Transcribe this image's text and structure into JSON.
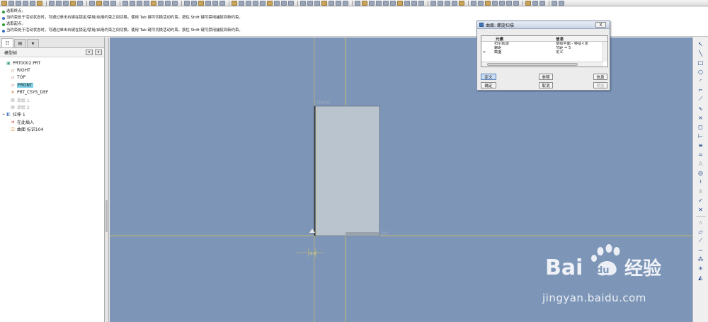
{
  "messages": [
    {
      "type": "ok",
      "text": "选取终点。"
    },
    {
      "type": "info",
      "text": "当约束处于活动状态时，可通过单击右键在锁定/禁用/启用约束之间切换。使用 Tab 键可切换活动约束。按住 Shift 键可禁用捕捉到新约束。"
    },
    {
      "type": "ok",
      "text": "选取起点。"
    },
    {
      "type": "info",
      "text": "当约束处于活动状态时，可通过单击右键在锁定/禁用/启用约束之间切换。使用 Tab 键可切换活动约束。按住 Shift 键可禁用捕捉到新约束。"
    }
  ],
  "model_tree": {
    "header": "模型树",
    "items": [
      {
        "label": "PRT0002.PRT",
        "icon": "part-icon",
        "indent": 0,
        "selected": false,
        "dim": false,
        "expander": ""
      },
      {
        "label": "RIGHT",
        "icon": "datum-plane-icon",
        "indent": 1,
        "selected": false,
        "dim": false,
        "expander": ""
      },
      {
        "label": "TOP",
        "icon": "datum-plane-icon",
        "indent": 1,
        "selected": false,
        "dim": false,
        "expander": ""
      },
      {
        "label": "FRONT",
        "icon": "datum-plane-icon",
        "indent": 1,
        "selected": true,
        "dim": false,
        "expander": ""
      },
      {
        "label": "PRT_CSYS_DEF",
        "icon": "csys-icon",
        "indent": 1,
        "selected": false,
        "dim": false,
        "expander": ""
      },
      {
        "label": "草绘 1",
        "icon": "sketch-icon",
        "indent": 1,
        "selected": false,
        "dim": true,
        "expander": ""
      },
      {
        "label": "草绘 2",
        "icon": "sketch-icon",
        "indent": 1,
        "selected": false,
        "dim": true,
        "expander": ""
      },
      {
        "label": "拉伸 1",
        "icon": "extrude-icon",
        "indent": 0,
        "selected": false,
        "dim": false,
        "expander": "+"
      },
      {
        "label": "在此插入",
        "icon": "insert-here-icon",
        "indent": 1,
        "selected": false,
        "dim": false,
        "expander": ""
      },
      {
        "label": "曲面 标识104",
        "icon": "surface-icon",
        "indent": 1,
        "selected": false,
        "dim": false,
        "expander": ""
      }
    ]
  },
  "dialog": {
    "title": "曲面: 螺旋扫描",
    "close_label": "X",
    "col_element": "元素",
    "col_info": "信息",
    "rows": [
      {
        "mark": "",
        "element": "扫引轨迹",
        "info": "草绘平面 - 特征<定"
      },
      {
        "mark": "",
        "element": "螺距",
        "info": "节距 = 5"
      },
      {
        "mark": ">",
        "element": "截面",
        "info": "定义"
      }
    ],
    "buttons": {
      "define": "定义",
      "refs": "参照",
      "info": "信息",
      "ok": "确定",
      "cancel": "取消",
      "preview": "预览"
    }
  },
  "graphics": {
    "labels": {
      "front": "FRONT",
      "top": "TOP",
      "dim_value": "0.0"
    },
    "colors": {
      "background": "#7d96b8",
      "surface": "#b9c4cf",
      "datum": "#d9c25a"
    }
  },
  "watermark": {
    "logo_latin": "Bai",
    "logo_du": "du",
    "logo_cn": "经验",
    "url": "jingyan.baidu.com"
  }
}
